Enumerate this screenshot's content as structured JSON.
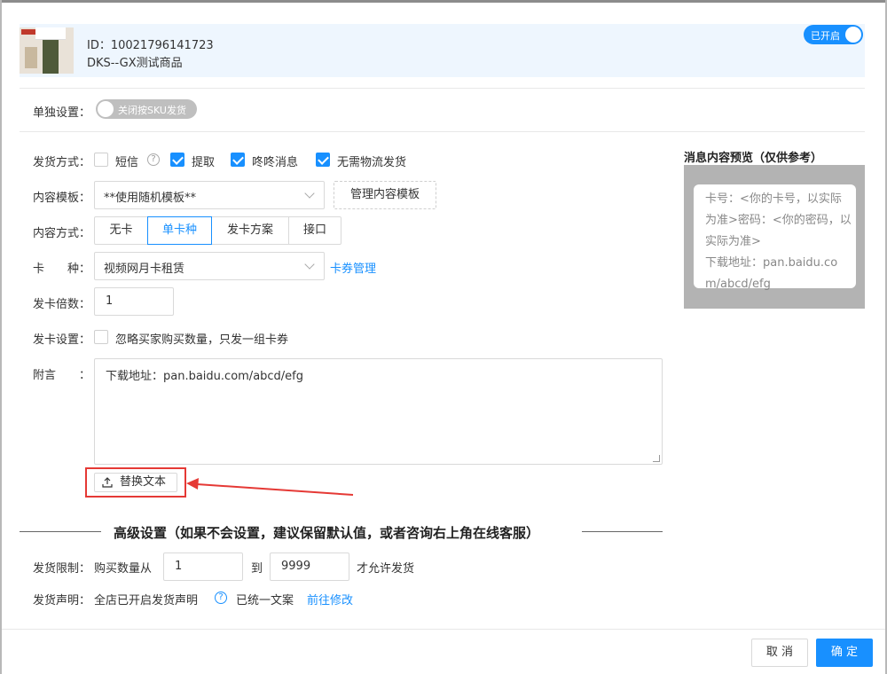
{
  "product": {
    "id_text": "ID：10021796141723",
    "name": "DKS--GX测试商品",
    "status_label": "已开启"
  },
  "solo": {
    "label": "单独设置：",
    "switch_label": "关闭按SKU发货"
  },
  "delivery": {
    "label": "发货方式：",
    "options": [
      {
        "label": "短信",
        "checked": false
      },
      {
        "label": "提取",
        "checked": true
      },
      {
        "label": "咚咚消息",
        "checked": true
      },
      {
        "label": "无需物流发货",
        "checked": true
      }
    ],
    "help_icon": "?"
  },
  "template": {
    "label": "内容模板：",
    "value": "**使用随机模板**",
    "manage_label": "管理内容模板"
  },
  "content_mode": {
    "label": "内容方式：",
    "options": [
      "无卡",
      "单卡种",
      "发卡方案",
      "接口"
    ],
    "selected": "单卡种"
  },
  "card_type": {
    "label": "卡　　种：",
    "value": "视频网月卡租赁",
    "manage_label": "卡券管理"
  },
  "multiplier": {
    "label": "发卡倍数：",
    "value": "1"
  },
  "card_setting": {
    "label": "发卡设置：",
    "option_label": "忽略买家购买数量，只发一组卡券",
    "checked": false
  },
  "note": {
    "label": "附言　　：",
    "value": "下载地址：pan.baidu.com/abcd/efg",
    "replace_label": "替换文本"
  },
  "advanced": {
    "title": "高级设置（如果不会设置，建议保留默认值，或者咨询右上角在线客服）",
    "limit_label": "发货限制：",
    "limit_prefix": "购买数量从",
    "limit_min": "1",
    "limit_to": "到",
    "limit_max": "9999",
    "limit_suffix": "才允许发货",
    "statement_label": "发货声明：",
    "statement_text": "全店已开启发货声明",
    "statement_unified": "已统一文案",
    "statement_link": "前往修改",
    "help_icon": "?"
  },
  "preview": {
    "title": "消息内容预览（仅供参考）",
    "content": "卡号：<你的卡号，以实际为准>密码：<你的密码，以实际为准>",
    "download": "下载地址：pan.baidu.com/abcd/efg"
  },
  "footer": {
    "cancel_label": "取 消",
    "ok_label": "确 定"
  },
  "colors": {
    "accent": "#1890ff",
    "highlight": "#e53935"
  }
}
